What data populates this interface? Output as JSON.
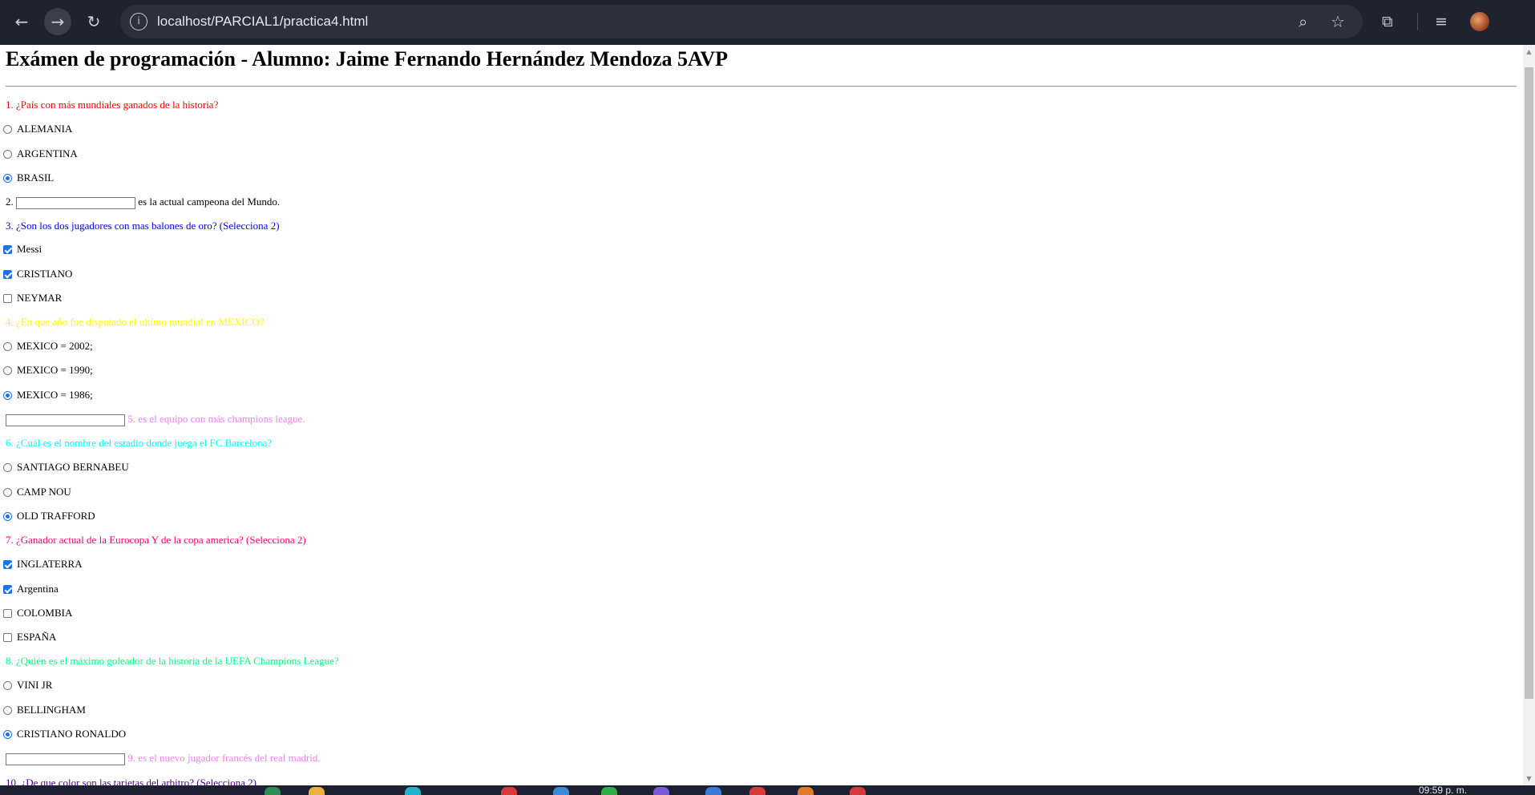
{
  "browser": {
    "url": "localhost/PARCIAL1/practica4.html",
    "icons": {
      "back": "arrow-left-icon",
      "forward": "arrow-right-icon",
      "reload": "reload-icon",
      "site_info": "info-icon",
      "zoom": "zoom-icon",
      "bookmark": "star-icon",
      "extensions": "puzzle-icon",
      "media": "media-queue-icon",
      "profile": "avatar-icon"
    }
  },
  "page": {
    "title": "Exámen de programación - Alumno: Jaime Fernando Hernández Mendoza 5AVP",
    "colors": {
      "q1": "#ff0000",
      "q3": "#0000ff",
      "q4": "#ffff00",
      "q5": "#ee82ee",
      "q6": "#00ffff",
      "q7": "#ff0066",
      "q8": "#00ff7f",
      "q10": "#4b0082",
      "checked": "#1a73e8"
    },
    "q1": {
      "text": "1. ¿País con más mundiales ganados de la historia?",
      "options": [
        "ALEMANIA",
        "ARGENTINA",
        "BRASIL"
      ],
      "selected": "BRASIL"
    },
    "q2": {
      "prefix": "2.",
      "value": "",
      "suffix": "es la actual campeona del Mundo."
    },
    "q3": {
      "text": "3. ¿Son los dos jugadores con mas balones de oro? (Selecciona 2)",
      "options": [
        "Messi",
        "CRISTIANO",
        "NEYMAR"
      ],
      "checked": [
        "Messi",
        "CRISTIANO"
      ]
    },
    "q4": {
      "text": "4. ¿En que año fue disputado el ultimo mundial en MEXICO?",
      "options": [
        "MEXICO = 2002;",
        "MEXICO = 1990;",
        "MEXICO = 1986;"
      ],
      "selected": "MEXICO = 1986;"
    },
    "q5": {
      "value": "",
      "suffix": "5. es el equipo con más champions league."
    },
    "q6": {
      "text": "6. ¿Cuál es el nombre del estadio donde juega el FC Barcelona?",
      "options": [
        "SANTIAGO BERNABEU",
        "CAMP NOU",
        "OLD TRAFFORD"
      ],
      "selected": "OLD TRAFFORD"
    },
    "q7": {
      "text": "7. ¿Ganador actual de la Eurocopa Y de la copa america? (Selecciona 2)",
      "options": [
        "INGLATERRA",
        "Argentina",
        "COLOMBIA",
        "ESPAÑA"
      ],
      "checked": [
        "INGLATERRA",
        "Argentina"
      ]
    },
    "q8": {
      "text": "8. ¿Quién es el máximo goleador de la historia de la UEFA Champions League?",
      "options": [
        "VINI JR",
        "BELLINGHAM",
        "CRISTIANO RONALDO"
      ],
      "selected": "CRISTIANO RONALDO"
    },
    "q9": {
      "value": "",
      "suffix": "9. es el nuevo jugador francés del real madrid."
    },
    "q10": {
      "text": "10. ¿De que color son las tarjetas del arbitro? (Selecciona 2)"
    }
  },
  "taskbar": {
    "clock": "09:59 p. m."
  }
}
